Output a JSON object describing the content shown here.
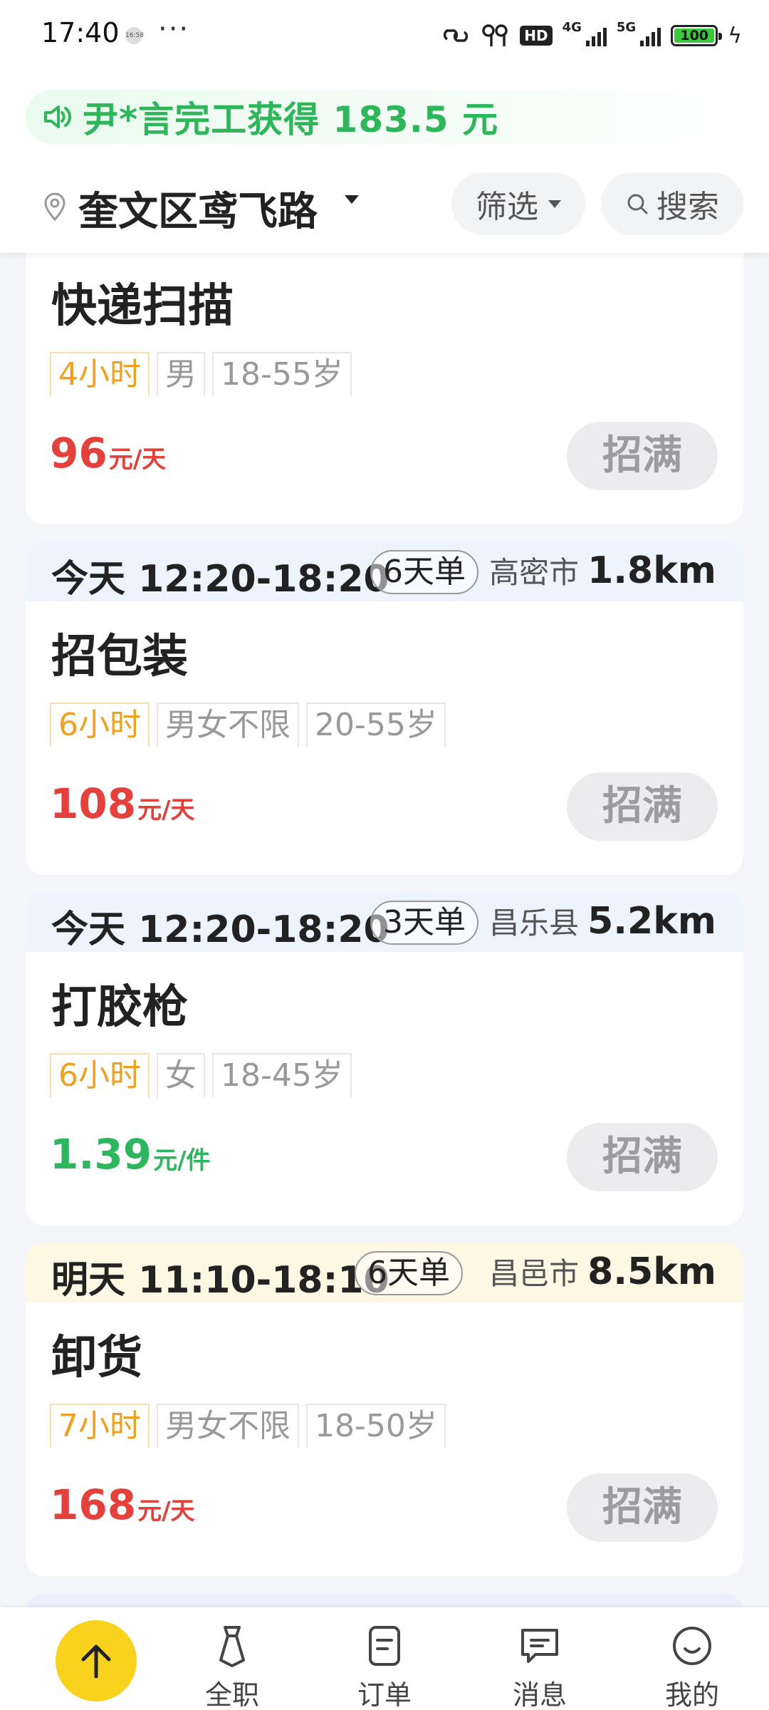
{
  "status_bar": {
    "time": "17:40",
    "tiny_badge": "16:58",
    "dots": "···",
    "hd": "HD",
    "net_4g": "4G",
    "net_5g": "5G",
    "battery": "100"
  },
  "banner": {
    "text": "尹*言完工获得 183.5 元"
  },
  "location": {
    "name": "奎文区鸢飞路",
    "filter_label": "筛选",
    "search_label": "搜索"
  },
  "jobs": [
    {
      "title": "快递扫描",
      "tags": [
        "4小时",
        "男",
        "18-55岁"
      ],
      "price": "96",
      "unit": "元/天",
      "button": "招满"
    },
    {
      "time": "今天 12:20-18:20",
      "days": "6天单",
      "city": "高密市",
      "distance": "1.8km",
      "title": "招包装",
      "tags": [
        "6小时",
        "男女不限",
        "20-55岁"
      ],
      "price": "108",
      "unit": "元/天",
      "button": "招满"
    },
    {
      "time": "今天 12:20-18:20",
      "days": "3天单",
      "city": "昌乐县",
      "distance": "5.2km",
      "title": "打胶枪",
      "tags": [
        "6小时",
        "女",
        "18-45岁"
      ],
      "price": "1.39",
      "unit": "元/件",
      "button": "招满"
    },
    {
      "time": "明天 11:10-18:10",
      "days": "6天单",
      "city": "昌邑市",
      "distance": "8.5km",
      "title": "卸货",
      "tags": [
        "7小时",
        "男女不限",
        "18-50岁"
      ],
      "price": "168",
      "unit": "元/天",
      "button": "招满"
    }
  ],
  "colors": {
    "price_red": "#e4413c",
    "price_green": "#2eb65e",
    "banner_green": "#2fb65a",
    "tag_orange": "#f0a020",
    "head_today": "#eef4fd",
    "head_tomorrow": "#fdf8e3",
    "fab_yellow": "#f8d21c"
  },
  "bottom_nav": {
    "items": [
      {
        "label": "全职",
        "icon": "tie-icon"
      },
      {
        "label": "订单",
        "icon": "document-icon"
      },
      {
        "label": "消息",
        "icon": "chat-icon"
      },
      {
        "label": "我的",
        "icon": "smile-icon"
      }
    ]
  }
}
